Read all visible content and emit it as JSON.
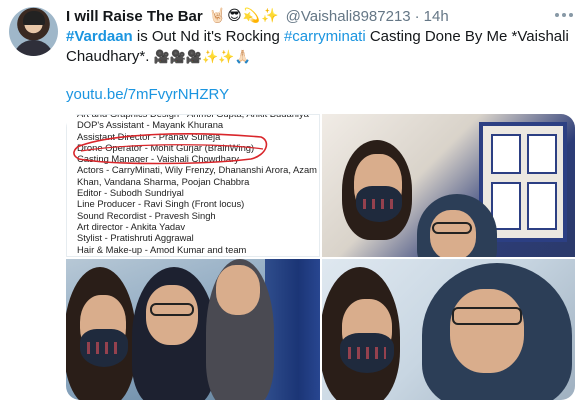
{
  "tweet": {
    "author_name": "I will Raise The Bar",
    "author_emojis": "🤘🏻😎💫✨",
    "handle": "@Vaishali8987213",
    "separator": "·",
    "time": "14h",
    "text_part1": "#Vardaan",
    "text_part2": " is Out Nd it's Rocking  ",
    "text_part3": "#carryminati",
    "text_part4": "   Casting Done By Me *Vaishali Chaudhary*. ",
    "text_emojis": "🎥🎥🎥✨✨🙏🏻",
    "link": "youtu.be/7mFvyrNHZRY"
  },
  "credits_image": {
    "lines": [
      "Art and Graphics Design - Anmol Gupta, Ankit Budaniya",
      "DOP's Assistant - Mayank Khurana",
      "Assistant Director - Pranav Suneja",
      "Drone Operator - Mohit Gurjar (BrainWing)",
      "Casting Manager - Vaishali Chowdhary",
      "Actors - CarryMinati, Wily Frenzy, Dhananshi  Arora, Azam",
      "Khan, Vandana Sharma, Poojan Chabbra",
      "Editor - Subodh Sundriyal",
      "Line Producer - Ravi Singh (Front locus)",
      "Sound Recordist - Pravesh Singh",
      "Art director -  Ankita Yadav",
      "Stylist - Pratishruti Aggrawal",
      "Hair & Make-up - Amod Kumar and team"
    ]
  },
  "colors": {
    "link": "#1b95e0",
    "muted": "#657786",
    "text": "#14171a",
    "scribble": "#d9262b"
  },
  "icons": [
    "more-options-icon"
  ]
}
